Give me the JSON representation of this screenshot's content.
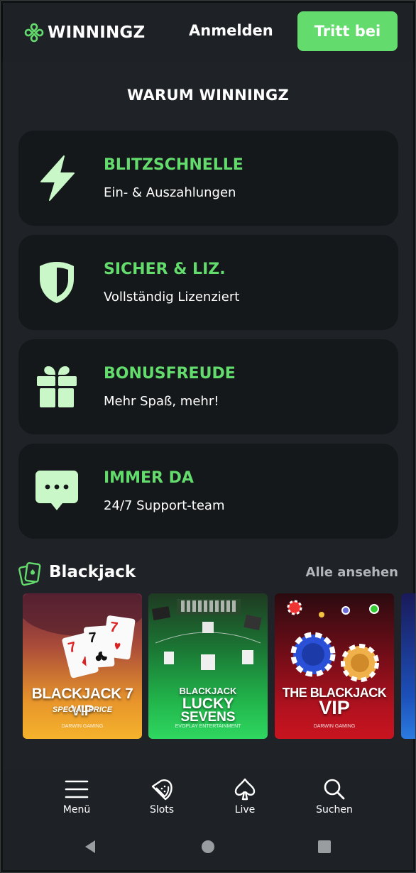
{
  "header": {
    "logo_text": "WINNINGZ",
    "login_label": "Anmelden",
    "join_label": "Tritt bei"
  },
  "why": {
    "title": "WARUM WINNINGZ",
    "features": [
      {
        "icon": "lightning-icon",
        "title": "BLITZSCHNELLE",
        "subtitle": "Ein- & Auszahlungen"
      },
      {
        "icon": "shield-icon",
        "title": "SICHER & LIZ.",
        "subtitle": "Vollständig Lizenziert"
      },
      {
        "icon": "gift-icon",
        "title": "BONUSFREUDE",
        "subtitle": "Mehr Spaß, mehr!"
      },
      {
        "icon": "chat-bubble-icon",
        "title": "IMMER DA",
        "subtitle": "24/7 Support-team"
      }
    ]
  },
  "blackjack": {
    "title": "Blackjack",
    "see_all": "Alle ansehen",
    "games": [
      {
        "name_line1": "BLACKJACK 7 VIP",
        "name_line2": "SPECIAL PRICE",
        "studio": "DARWIN GAMING"
      },
      {
        "name_line1": "BLACKJACK",
        "name_line2": "LUCKY",
        "name_line3": "SEVENS",
        "studio": "EVOPLAY ENTERTAINMENT"
      },
      {
        "name_line1": "THE BLACKJACK",
        "name_line2": "VIP",
        "studio": "DARWIN GAMING"
      }
    ]
  },
  "bottom_nav": [
    {
      "icon": "menu-icon",
      "label": "Menü"
    },
    {
      "icon": "watermelon-icon",
      "label": "Slots"
    },
    {
      "icon": "spade-icon",
      "label": "Live"
    },
    {
      "icon": "search-icon",
      "label": "Suchen"
    }
  ],
  "colors": {
    "accent": "#63dc6d",
    "background": "#1f2327",
    "card": "#15181a"
  }
}
